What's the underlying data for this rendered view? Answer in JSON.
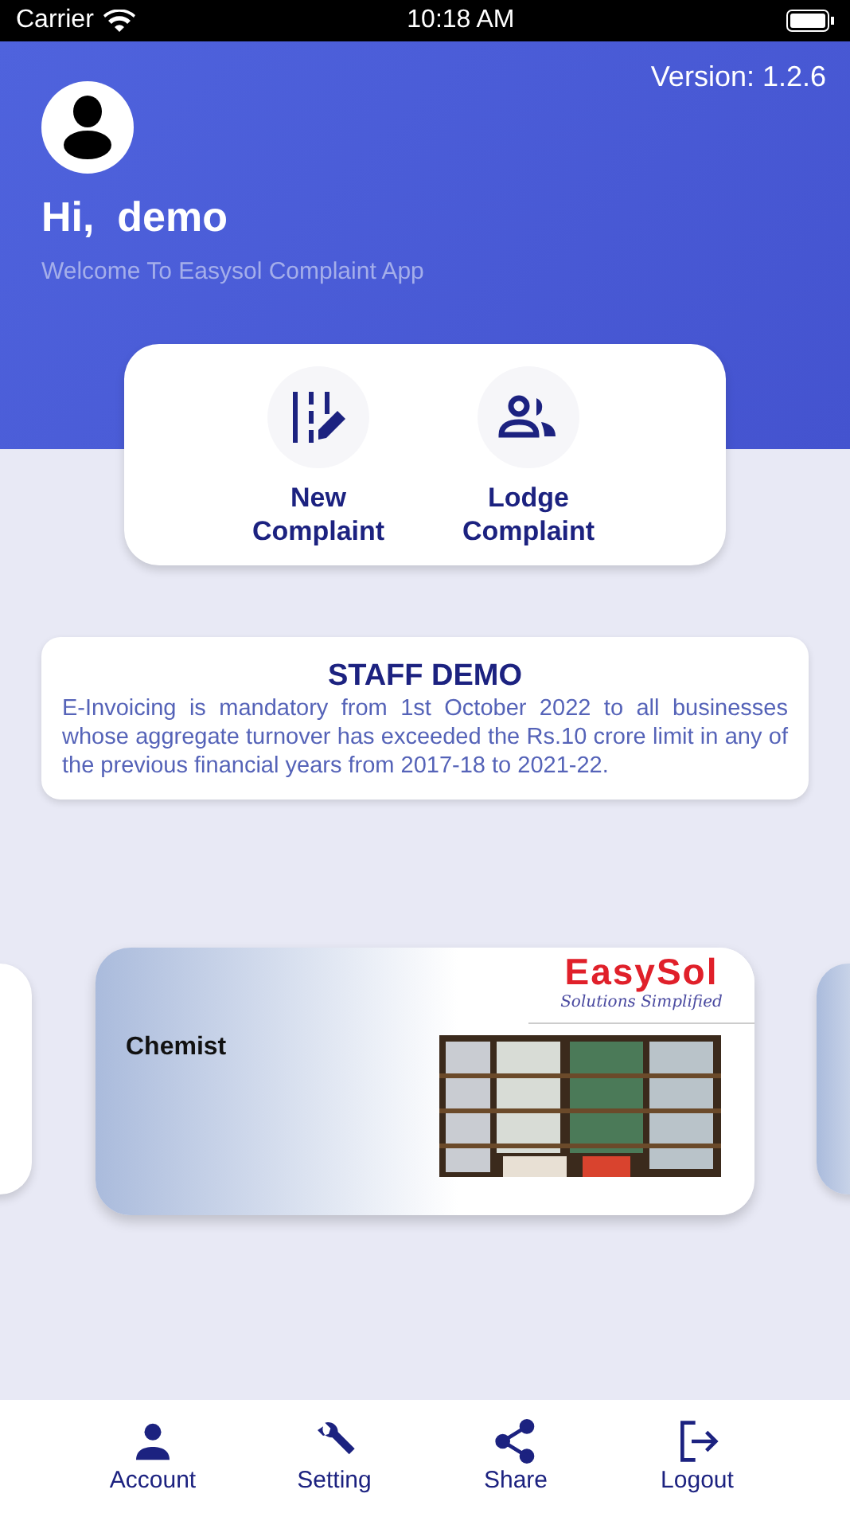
{
  "status_bar": {
    "carrier": "Carrier",
    "time": "10:18 AM"
  },
  "header": {
    "version": "Version: 1.2.6",
    "greeting": "Hi,  demo",
    "subtitle": "Welcome To Easysol Complaint App"
  },
  "actions": [
    {
      "kind": "new",
      "label": "New Complaint"
    },
    {
      "kind": "lodge",
      "label": "Lodge Complaint"
    }
  ],
  "notice": {
    "title": "STAFF DEMO",
    "body": "E-Invoicing is mandatory from 1st October 2022 to all businesses whose aggregate turnover has exceeded the Rs.10 crore limit in any of the previous financial years from 2017-18 to 2021-22."
  },
  "banner": {
    "title": "Chemist",
    "logo": "EasySol",
    "tagline": "Solutions Simplified"
  },
  "bottom_nav": [
    {
      "kind": "account",
      "label": "Account"
    },
    {
      "kind": "setting",
      "label": "Setting"
    },
    {
      "kind": "share",
      "label": "Share"
    },
    {
      "kind": "logout",
      "label": "Logout"
    }
  ]
}
